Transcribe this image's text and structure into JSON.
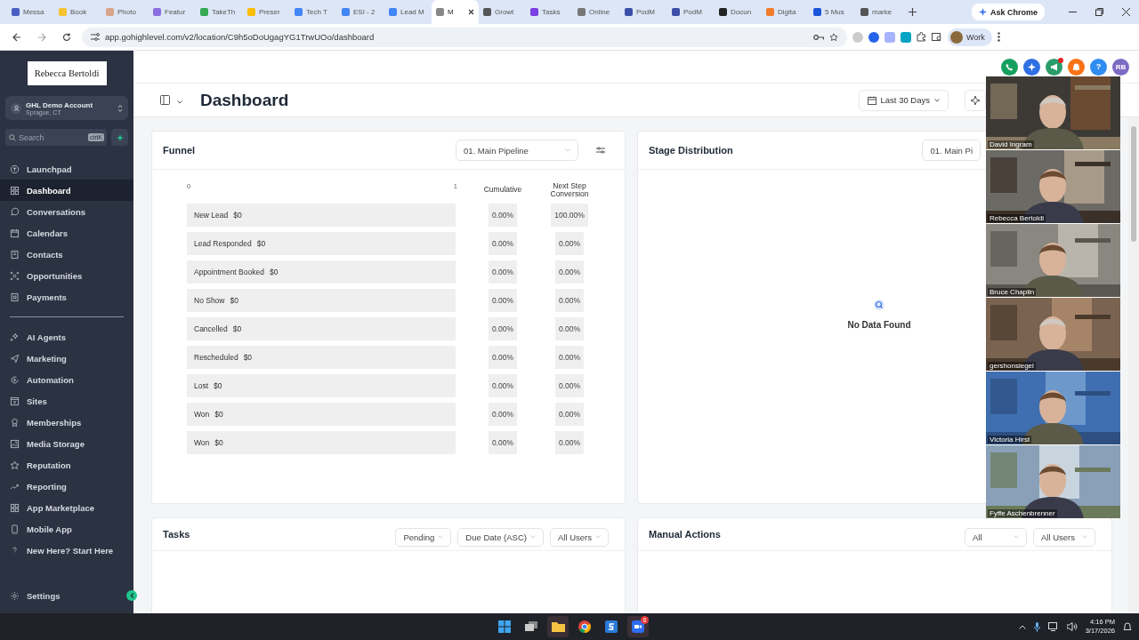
{
  "browser": {
    "tabs": [
      {
        "title": "Messa",
        "selected": false
      },
      {
        "title": "Book",
        "selected": false
      },
      {
        "title": "Photo",
        "selected": false
      },
      {
        "title": "Featur",
        "selected": false
      },
      {
        "title": "TakeTh",
        "selected": false
      },
      {
        "title": "Preser",
        "selected": false
      },
      {
        "title": "Tech T",
        "selected": false
      },
      {
        "title": "ESI - 2",
        "selected": false
      },
      {
        "title": "Lead M",
        "selected": false
      },
      {
        "title": "M",
        "selected": true
      },
      {
        "title": "Growt",
        "selected": false
      },
      {
        "title": "Tasks",
        "selected": false
      },
      {
        "title": "Online",
        "selected": false
      },
      {
        "title": "PodM",
        "selected": false
      },
      {
        "title": "PodM",
        "selected": false
      },
      {
        "title": "Docun",
        "selected": false
      },
      {
        "title": "Digita",
        "selected": false
      },
      {
        "title": "5 Mus",
        "selected": false
      },
      {
        "title": "marke",
        "selected": false
      }
    ],
    "ask_chrome": "Ask Chrome",
    "url": "app.gohighlevel.com/v2/location/C9h5oDoUgagYG1TrwUOo/dashboard",
    "profile": "Work"
  },
  "sidebar": {
    "logo": "Rebecca Bertoldi",
    "account": {
      "name": "GHL Demo Account",
      "location": "Sprague, CT"
    },
    "search": {
      "placeholder": "Search",
      "shortcut": "ctrlK"
    },
    "items": [
      {
        "label": "Launchpad",
        "selected": false
      },
      {
        "label": "Dashboard",
        "selected": true
      },
      {
        "label": "Conversations",
        "selected": false
      },
      {
        "label": "Calendars",
        "selected": false
      },
      {
        "label": "Contacts",
        "selected": false
      },
      {
        "label": "Opportunities",
        "selected": false
      },
      {
        "label": "Payments",
        "selected": false
      }
    ],
    "items_2": [
      {
        "label": "AI Agents",
        "selected": false
      },
      {
        "label": "Marketing",
        "selected": false
      },
      {
        "label": "Automation",
        "selected": false
      },
      {
        "label": "Sites",
        "selected": false
      },
      {
        "label": "Memberships",
        "selected": false
      },
      {
        "label": "Media Storage",
        "selected": false
      },
      {
        "label": "Reputation",
        "selected": false
      },
      {
        "label": "Reporting",
        "selected": false
      },
      {
        "label": "App Marketplace",
        "selected": false
      },
      {
        "label": "Mobile App",
        "selected": false
      },
      {
        "label": "New Here? Start Here",
        "selected": false
      }
    ],
    "settings": "Settings"
  },
  "topbar": {
    "help": "?",
    "avatar": "RB"
  },
  "header": {
    "title": "Dashboard",
    "date_range": "Last 30 Days"
  },
  "funnel": {
    "title": "Funnel",
    "pipeline": "01. Main Pipeline",
    "axis_min": "0",
    "axis_max": "1",
    "columns": [
      "Cumulative",
      "Next Step Conversion"
    ],
    "stages": [
      {
        "label": "New Lead",
        "value": "$0",
        "cumulative": "0.00%",
        "next_step": "100.00%"
      },
      {
        "label": "Lead Responded",
        "value": "$0",
        "cumulative": "0.00%",
        "next_step": "0.00%"
      },
      {
        "label": "Appointment Booked",
        "value": "$0",
        "cumulative": "0.00%",
        "next_step": "0.00%"
      },
      {
        "label": "No Show",
        "value": "$0",
        "cumulative": "0.00%",
        "next_step": "0.00%"
      },
      {
        "label": "Cancelled",
        "value": "$0",
        "cumulative": "0.00%",
        "next_step": "0.00%"
      },
      {
        "label": "Rescheduled",
        "value": "$0",
        "cumulative": "0.00%",
        "next_step": "0.00%"
      },
      {
        "label": "Lost",
        "value": "$0",
        "cumulative": "0.00%",
        "next_step": "0.00%"
      },
      {
        "label": "Won",
        "value": "$0",
        "cumulative": "0.00%",
        "next_step": "0.00%"
      },
      {
        "label": "Won",
        "value": "$0",
        "cumulative": "0.00%",
        "next_step": "0.00%"
      }
    ]
  },
  "stage_distribution": {
    "title": "Stage Distribution",
    "pipeline": "01. Main Pi",
    "empty_message": "No Data Found"
  },
  "tasks": {
    "title": "Tasks",
    "filters": [
      "Pending",
      "Due Date (ASC)",
      "All Users"
    ]
  },
  "manual_actions": {
    "title": "Manual Actions",
    "filters": [
      "All",
      "All Users"
    ]
  },
  "video_call": {
    "participants": [
      {
        "name": "David Ingram"
      },
      {
        "name": "Rebecca Bertoldi"
      },
      {
        "name": "Bruce Chaplin"
      },
      {
        "name": "gershonsiegel"
      },
      {
        "name": "Victoria Hirst"
      },
      {
        "name": "Fyffe Aschenbrenner"
      }
    ]
  },
  "taskbar": {
    "zoom_badge": "6",
    "time": "4:16 PM",
    "date": "3/17/2026"
  }
}
